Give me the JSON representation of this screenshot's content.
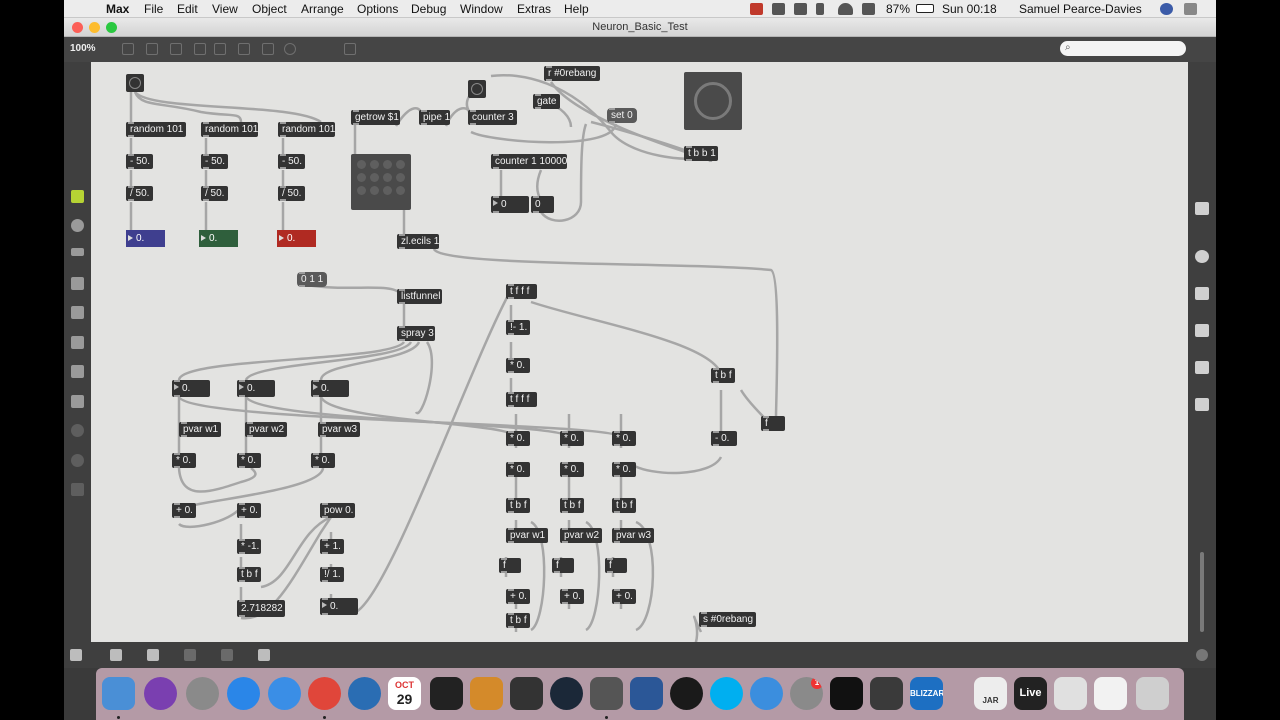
{
  "menubar": {
    "app_name": "Max",
    "items": [
      "File",
      "Edit",
      "View",
      "Object",
      "Arrange",
      "Options",
      "Debug",
      "Window",
      "Extras",
      "Help"
    ],
    "battery": "87%",
    "clock": "Sun 00:18",
    "user": "Samuel Pearce-Davies"
  },
  "window": {
    "title": "Neuron_Basic_Test",
    "zoom": "100%"
  },
  "patch": {
    "random1": "random 101",
    "random2": "random 101",
    "random3": "random 101",
    "sub1": "- 50.",
    "sub2": "- 50.",
    "sub3": "- 50.",
    "div1": "/ 50.",
    "div2": "/ 50.",
    "div3": "/ 50.",
    "out_blue": "0.",
    "out_green": "0.",
    "out_red": "0.",
    "getrow": "getrow $1",
    "pipe": "pipe 1",
    "counter3": "counter 3",
    "r_rebang": "r #0rebang",
    "gate": "gate",
    "set0": "set 0",
    "counter10000": "counter 1 10000",
    "count_num1": "0",
    "count_num2": "0",
    "tbb1": "t b b 1",
    "zlecils": "zl.ecils 1",
    "msg011": "0 1 1",
    "listfunnel": "listfunnel",
    "spray": "spray 3",
    "in1": "0.",
    "in2": "0.",
    "in3": "0.",
    "pvw1": "pvar w1",
    "pvw2": "pvar w2",
    "pvw3": "pvar w3",
    "mul_a": "* 0.",
    "mul_b": "* 0.",
    "mul_c": "* 0.",
    "add_a": "+ 0.",
    "add_b": "+ 0.",
    "pow": "pow 0.",
    "neg1": "* -1.",
    "plus1": "+ 1.",
    "rdiv1": "!/ 1.",
    "tbf_left": "t b f",
    "euler": "2.718282",
    "sigmoid_out": "0.",
    "tfff_top": "t f f f",
    "rsub1": "!- 1.",
    "mul_mid": "* 0.",
    "tfff_mid": "t f f f",
    "m1": "* 0.",
    "m2": "* 0.",
    "m3": "* 0.",
    "m4": "* 0.",
    "m5": "* 0.",
    "m6": "* 0.",
    "tbf1": "t b f",
    "tbf2": "t b f",
    "tbf3": "t b f",
    "pvw1b": "pvar w1",
    "pvw2b": "pvar w2",
    "pvw3b": "pvar w3",
    "f1": "f",
    "f2": "f",
    "f3": "f",
    "p1": "+ 0.",
    "p2": "+ 0.",
    "p3": "+ 0.",
    "tbf_bottom": "t b f",
    "tbf_right": "t b f",
    "f_right": "f",
    "sub_right": "- 0.",
    "s_rebang": "s #0rebang"
  },
  "colors": {
    "out_blue": "#3f3f8f",
    "out_green": "#2f5f3c",
    "out_red": "#b02a22",
    "canvas": "#e3e3e1",
    "object": "#333333"
  },
  "dock": {
    "calendar_month": "OCT",
    "calendar_day": "29",
    "badge": "1",
    "live": "Live",
    "jar": "JAR",
    "blizzard": "BLIZZARD"
  }
}
